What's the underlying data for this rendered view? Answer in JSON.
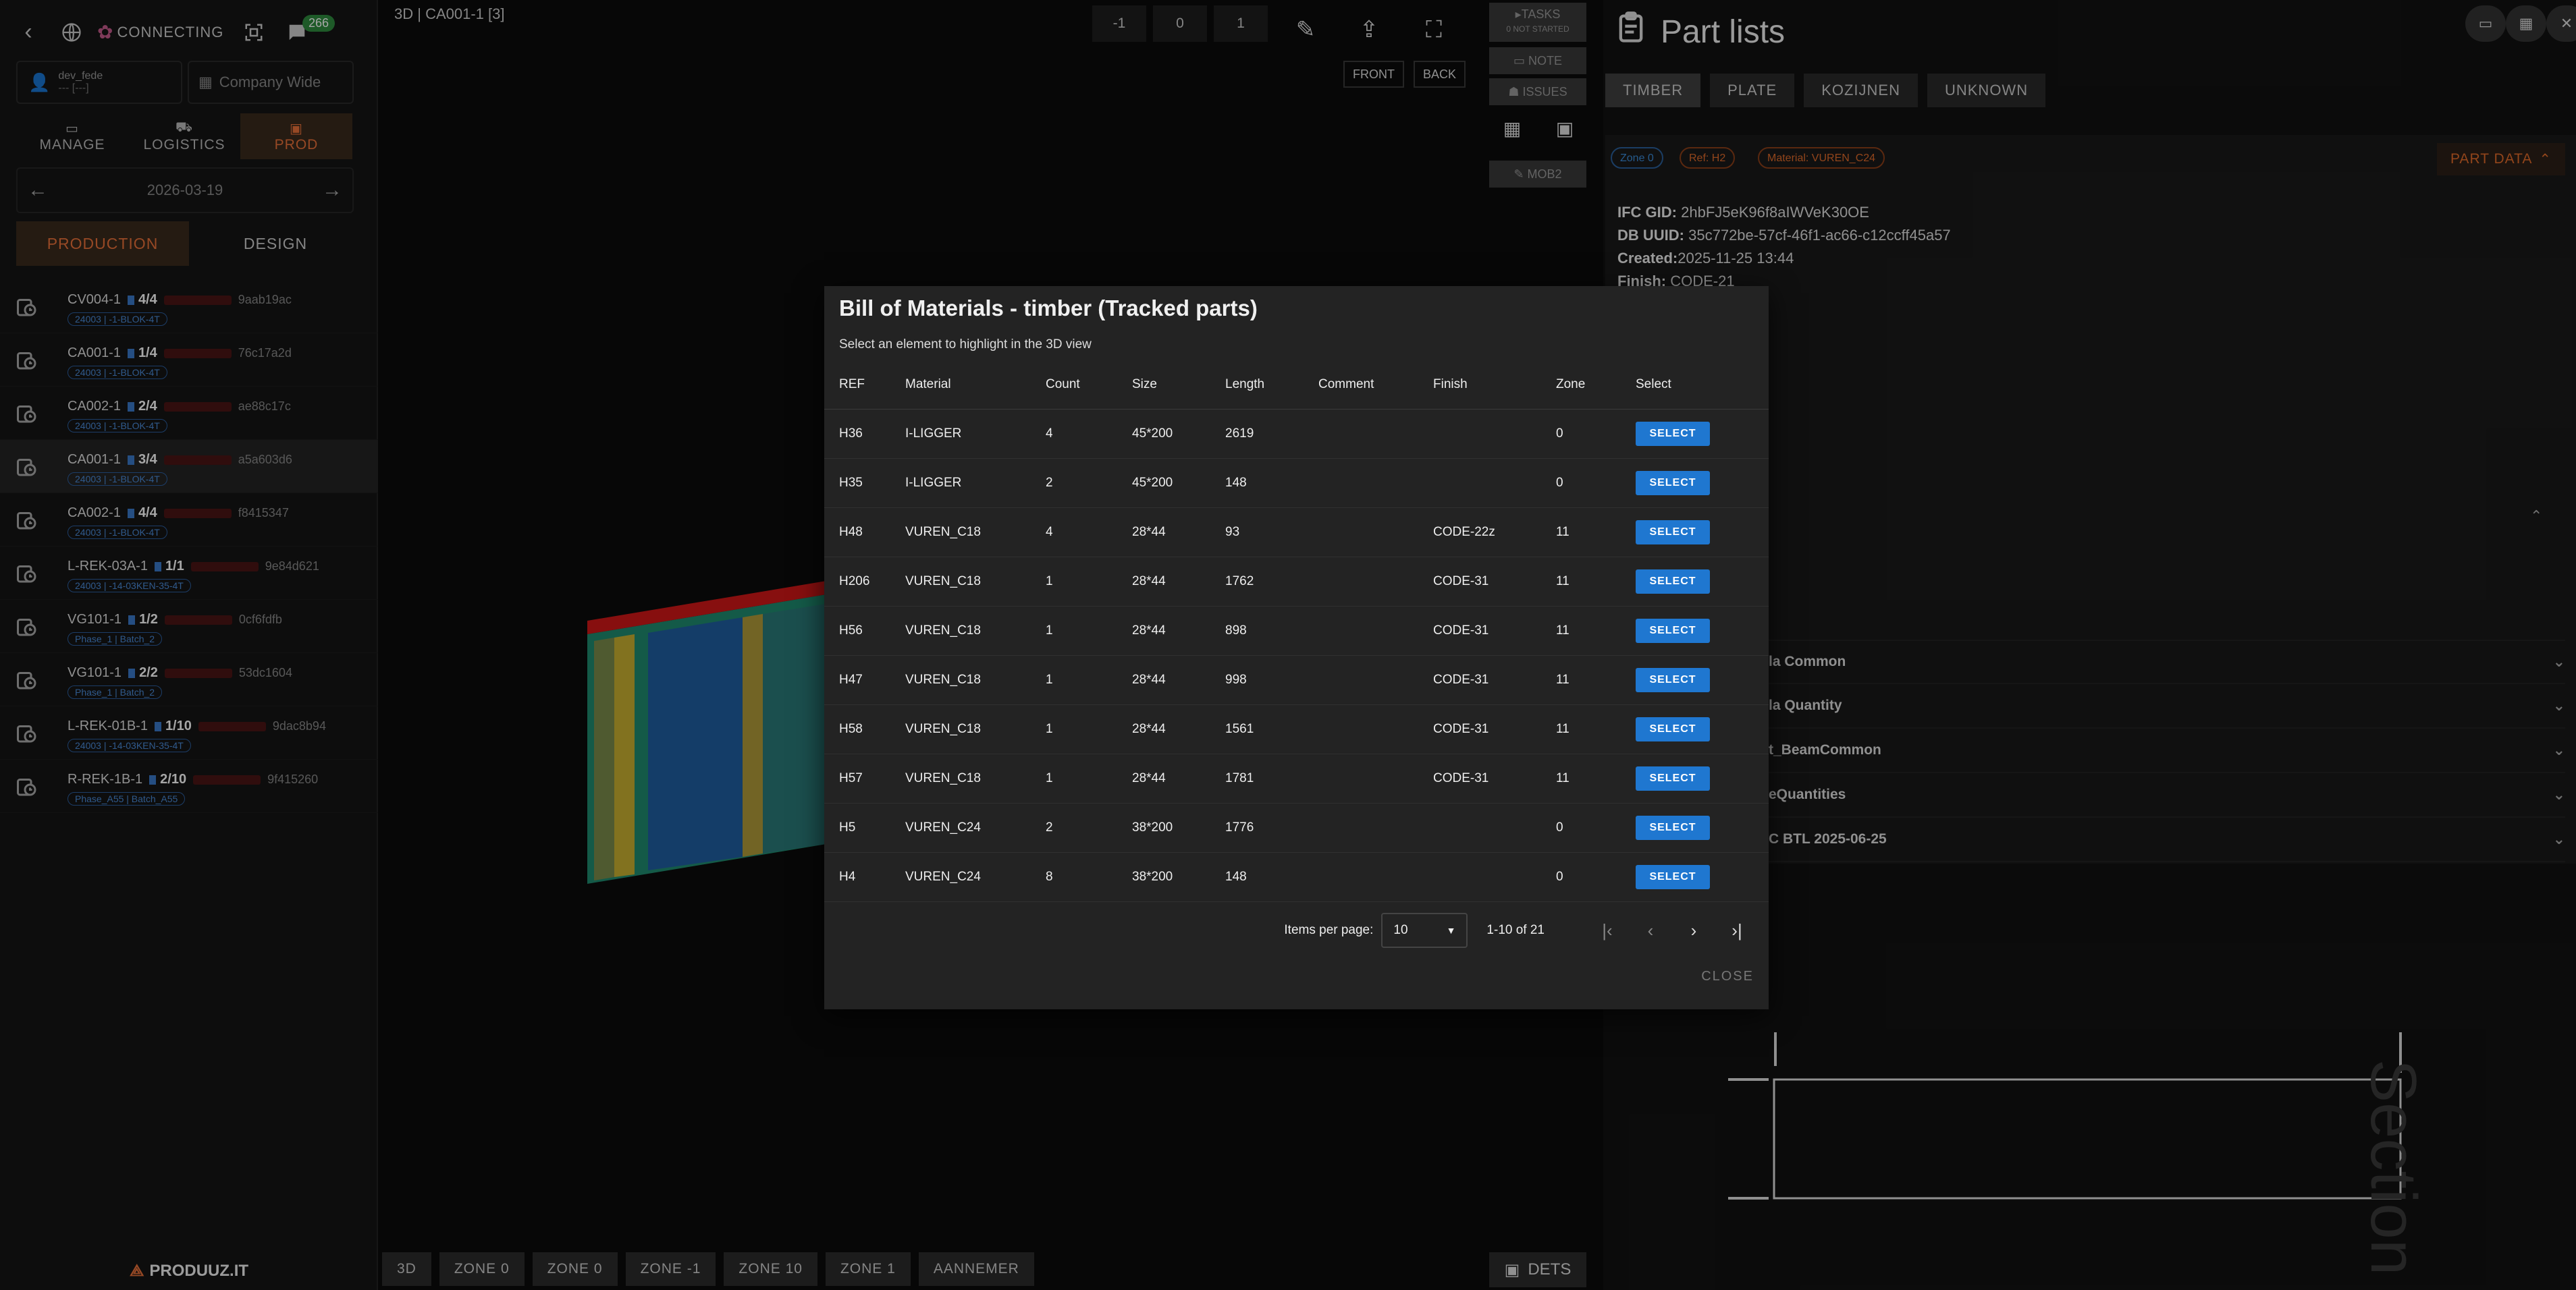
{
  "sidebar": {
    "logo": "CONNECTING",
    "notification_count": "266",
    "user_name": "dev_fede",
    "user_sub": "--- [---]",
    "company": "Company Wide",
    "modes": [
      "MANAGE",
      "LOGISTICS",
      "PROD"
    ],
    "date": "2026-03-19",
    "tabs": [
      "PRODUCTION",
      "DESIGN"
    ],
    "items": [
      {
        "name": "CV004-1",
        "count": "4/4",
        "hash": "9aab19ac",
        "tag": "24003 | -1-BLOK-4T"
      },
      {
        "name": "CA001-1",
        "count": "1/4",
        "hash": "76c17a2d",
        "tag": "24003 | -1-BLOK-4T"
      },
      {
        "name": "CA002-1",
        "count": "2/4",
        "hash": "ae88c17c",
        "tag": "24003 | -1-BLOK-4T"
      },
      {
        "name": "CA001-1",
        "count": "3/4",
        "hash": "a5a603d6",
        "tag": "24003 | -1-BLOK-4T"
      },
      {
        "name": "CA002-1",
        "count": "4/4",
        "hash": "f8415347",
        "tag": "24003 | -1-BLOK-4T"
      },
      {
        "name": "L-REK-03A-1",
        "count": "1/1",
        "hash": "9e84d621",
        "tag": "24003 | -14-03KEN-35-4T"
      },
      {
        "name": "VG101-1",
        "count": "1/2",
        "hash": "0cf6fdfb",
        "tag": "Phase_1 | Batch_2"
      },
      {
        "name": "VG101-1",
        "count": "2/2",
        "hash": "53dc1604",
        "tag": "Phase_1 | Batch_2"
      },
      {
        "name": "L-REK-01B-1",
        "count": "1/10",
        "hash": "9dac8b94",
        "tag": "24003 | -14-03KEN-35-4T"
      },
      {
        "name": "R-REK-1B-1",
        "count": "2/10",
        "hash": "9f415260",
        "tag": "Phase_A55 | Batch_A55"
      }
    ],
    "footer": "PRODUUZ.IT"
  },
  "viewer": {
    "title": "3D | CA001-1 [3]",
    "vector": [
      "-1",
      "0",
      "1"
    ],
    "front": "FRONT",
    "back": "BACK",
    "tasks": "TASKS",
    "tasks_sub": "0 NOT STARTED",
    "note": "NOTE",
    "issues": "ISSUES",
    "mob2": "MOB2",
    "zones": [
      "3D",
      "ZONE 0",
      "ZONE 0",
      "ZONE -1",
      "ZONE 10",
      "ZONE 1",
      "AANNEMER"
    ],
    "dets": "DETS"
  },
  "rpanel": {
    "title": "Part lists",
    "tabs": [
      "TIMBER",
      "PLATE",
      "KOZIJNEN",
      "UNKNOWN"
    ],
    "chips": [
      "Zone 0",
      "Ref: H2",
      "Material: VUREN_C24"
    ],
    "part_data": "PART DATA",
    "meta": [
      {
        "label": "IFC GID:",
        "value": "2hbFJ5eK96f8aIWVeK30OE"
      },
      {
        "label": "DB UUID:",
        "value": "35c772be-57cf-46f1-ac66-c12ccff45a57"
      },
      {
        "label": "Created:",
        "value": "2025-11-25 13:44"
      },
      {
        "label": "Finish:",
        "value": "CODE-21"
      }
    ],
    "accordions": [
      "la Common",
      "la Quantity",
      "t_BeamCommon",
      "eQuantities",
      "C BTL 2025-06-25"
    ],
    "section_text": "Section"
  },
  "modal": {
    "title": "Bill of Materials - timber (Tracked parts)",
    "subtitle": "Select an element to highlight in the 3D view",
    "columns": [
      "REF",
      "Material",
      "Count",
      "Size",
      "Length",
      "Comment",
      "Finish",
      "Zone",
      "Select"
    ],
    "rows": [
      [
        "H36",
        "I-LIGGER",
        "4",
        "45*200",
        "2619",
        "",
        "",
        "0"
      ],
      [
        "H35",
        "I-LIGGER",
        "2",
        "45*200",
        "148",
        "",
        "",
        "0"
      ],
      [
        "H48",
        "VUREN_C18",
        "4",
        "28*44",
        "93",
        "",
        "CODE-22z",
        "11"
      ],
      [
        "H206",
        "VUREN_C18",
        "1",
        "28*44",
        "1762",
        "",
        "CODE-31",
        "11"
      ],
      [
        "H56",
        "VUREN_C18",
        "1",
        "28*44",
        "898",
        "",
        "CODE-31",
        "11"
      ],
      [
        "H47",
        "VUREN_C18",
        "1",
        "28*44",
        "998",
        "",
        "CODE-31",
        "11"
      ],
      [
        "H58",
        "VUREN_C18",
        "1",
        "28*44",
        "1561",
        "",
        "CODE-31",
        "11"
      ],
      [
        "H57",
        "VUREN_C18",
        "1",
        "28*44",
        "1781",
        "",
        "CODE-31",
        "11"
      ],
      [
        "H5",
        "VUREN_C24",
        "2",
        "38*200",
        "1776",
        "",
        "",
        "0"
      ],
      [
        "H4",
        "VUREN_C24",
        "8",
        "38*200",
        "148",
        "",
        "",
        "0"
      ]
    ],
    "select_label": "SELECT",
    "items_per_page_label": "Items per page:",
    "items_per_page": "10",
    "range": "1-10 of 21",
    "close": "CLOSE"
  },
  "colors": {
    "accent": "#e8703a",
    "select_blue": "#1f77d0",
    "badge_green": "#2e8b3e"
  }
}
